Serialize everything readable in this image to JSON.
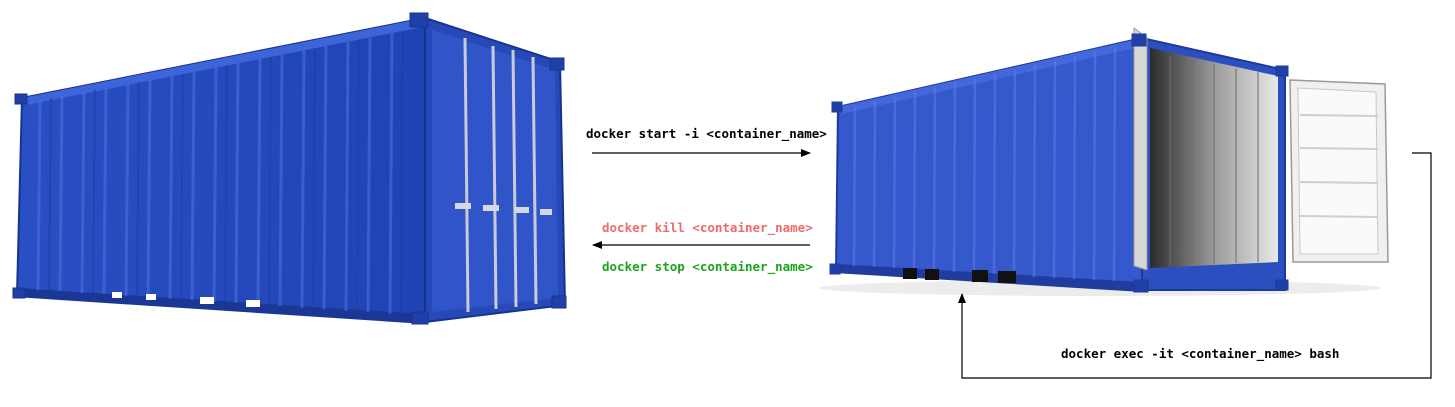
{
  "labels": {
    "start": "docker start -i <container_name>",
    "kill": "docker kill <container_name>",
    "stop": "docker stop <container_name>",
    "exec": "docker exec -it <container_name> bash"
  },
  "colors": {
    "kill": "#f06a6a",
    "stop": "#1aa51a",
    "container_blue": "#2f55c8",
    "container_dark": "#1c3a9a",
    "container_light": "#4a6fe0"
  },
  "icons": {
    "left": "closed-shipping-container",
    "right": "open-shipping-container"
  }
}
